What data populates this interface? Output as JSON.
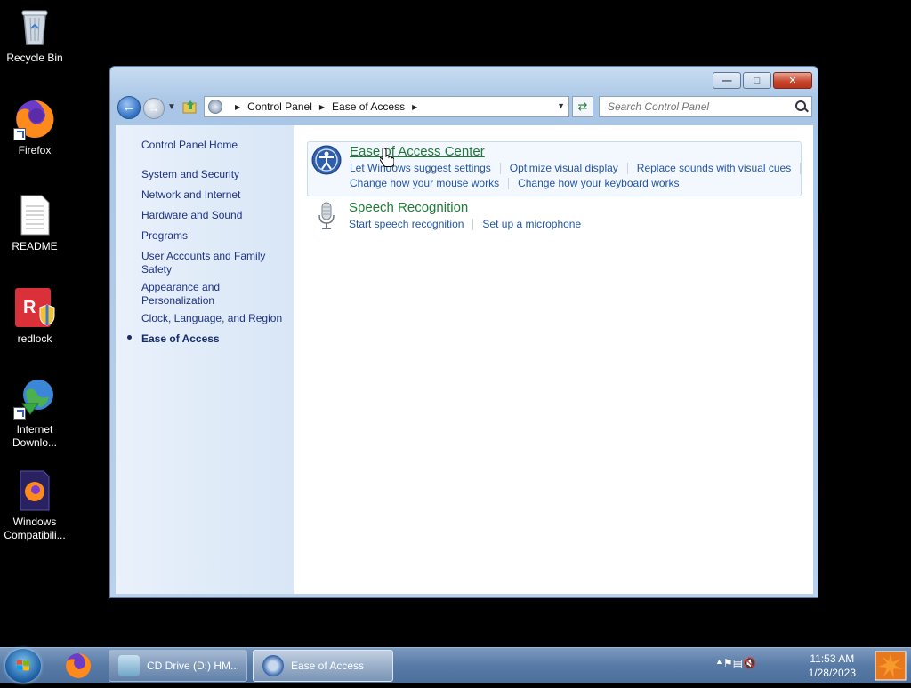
{
  "desktop": {
    "icons": [
      {
        "label": "Recycle Bin"
      },
      {
        "label": "Firefox"
      },
      {
        "label": "README"
      },
      {
        "label": "redlock"
      },
      {
        "label": "Internet Downlo..."
      },
      {
        "label": "Windows Compatibili..."
      }
    ]
  },
  "window": {
    "caption_buttons": {
      "minimize": "—",
      "maximize": "□",
      "close": "✕"
    },
    "address": {
      "crumbs": [
        "Control Panel",
        "Ease of Access"
      ]
    },
    "search": {
      "placeholder": "Search Control Panel"
    },
    "left_nav": [
      {
        "label": "Control Panel Home"
      },
      {
        "label": "System and Security"
      },
      {
        "label": "Network and Internet"
      },
      {
        "label": "Hardware and Sound"
      },
      {
        "label": "Programs"
      },
      {
        "label": "User Accounts and Family Safety"
      },
      {
        "label": "Appearance and Personalization"
      },
      {
        "label": "Clock, Language, and Region"
      },
      {
        "label": "Ease of Access",
        "current": true
      }
    ],
    "categories": [
      {
        "title": "Ease of Access Center",
        "links_row1": [
          "Let Windows suggest settings",
          "Optimize visual display",
          "Replace sounds with visual cues"
        ],
        "links_row2": [
          "Change how your mouse works",
          "Change how your keyboard works"
        ]
      },
      {
        "title": "Speech Recognition",
        "links_row1": [
          "Start speech recognition",
          "Set up a microphone"
        ]
      }
    ]
  },
  "taskbar": {
    "buttons": [
      {
        "label": "CD Drive (D:) HM..."
      },
      {
        "label": "Ease of Access",
        "active": true
      }
    ],
    "clock": {
      "time": "11:53 AM",
      "date": "1/28/2023"
    }
  },
  "colors": {
    "link": "#2355a8",
    "category_title": "#1e7c37",
    "nav_text": "#1e3287",
    "taskbar": "#577aa6"
  }
}
